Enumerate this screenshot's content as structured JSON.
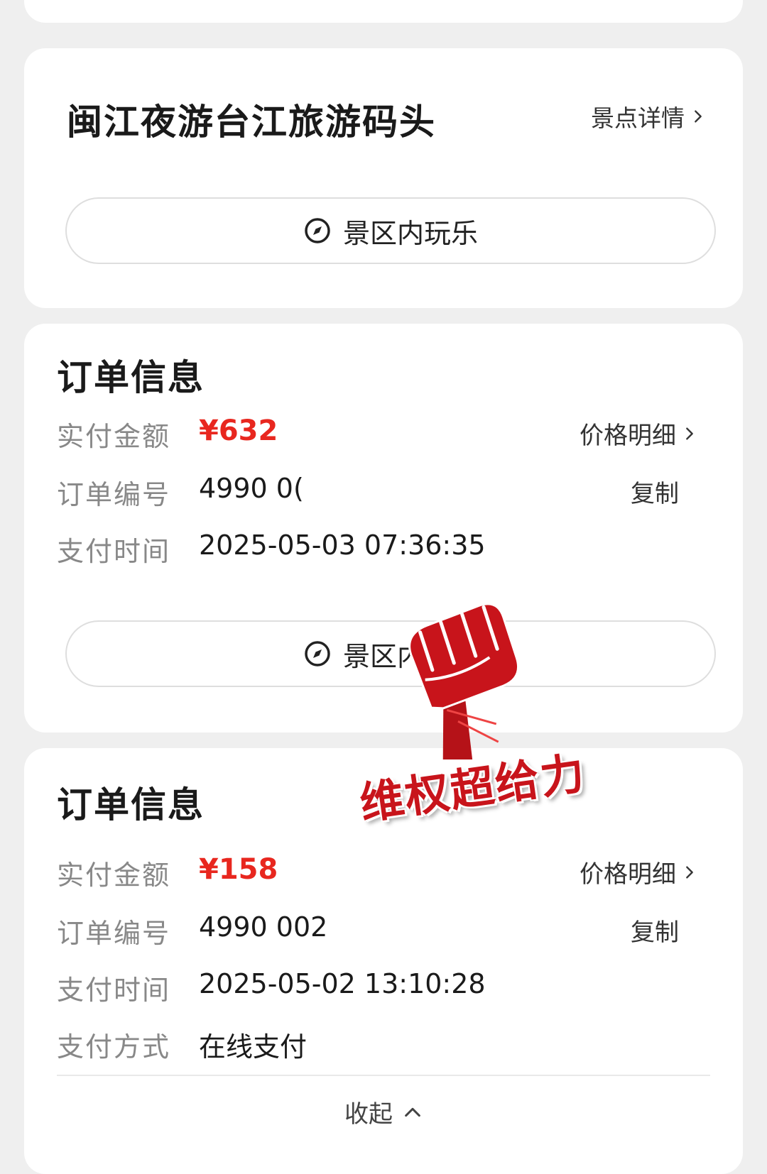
{
  "spot": {
    "title": "闽江夜游台江旅游码头",
    "detail_link": "景点详情",
    "play_button": "景区内玩乐"
  },
  "order1": {
    "section_title": "订单信息",
    "amount_label": "实付金额",
    "amount_value": "¥632",
    "price_detail_link": "价格明细",
    "order_no_label": "订单编号",
    "order_no_value": "4990 0(",
    "copy_button": "复制",
    "pay_time_label": "支付时间",
    "pay_time_value": "2025-05-03 07:36:35",
    "play_button": "景区内玩乐"
  },
  "order2": {
    "section_title": "订单信息",
    "amount_label": "实付金额",
    "amount_value": "¥158",
    "price_detail_link": "价格明细",
    "order_no_label": "订单编号",
    "order_no_value": "4990 002",
    "copy_button": "复制",
    "pay_time_label": "支付时间",
    "pay_time_value": "2025-05-02 13:10:28",
    "pay_method_label": "支付方式",
    "pay_method_value": "在线支付",
    "collapse_label": "收起"
  },
  "overlay": {
    "sticker_text": "维权超给力"
  },
  "colors": {
    "price": "#e8271f",
    "sticker": "#c8141b",
    "background": "#efefef"
  }
}
